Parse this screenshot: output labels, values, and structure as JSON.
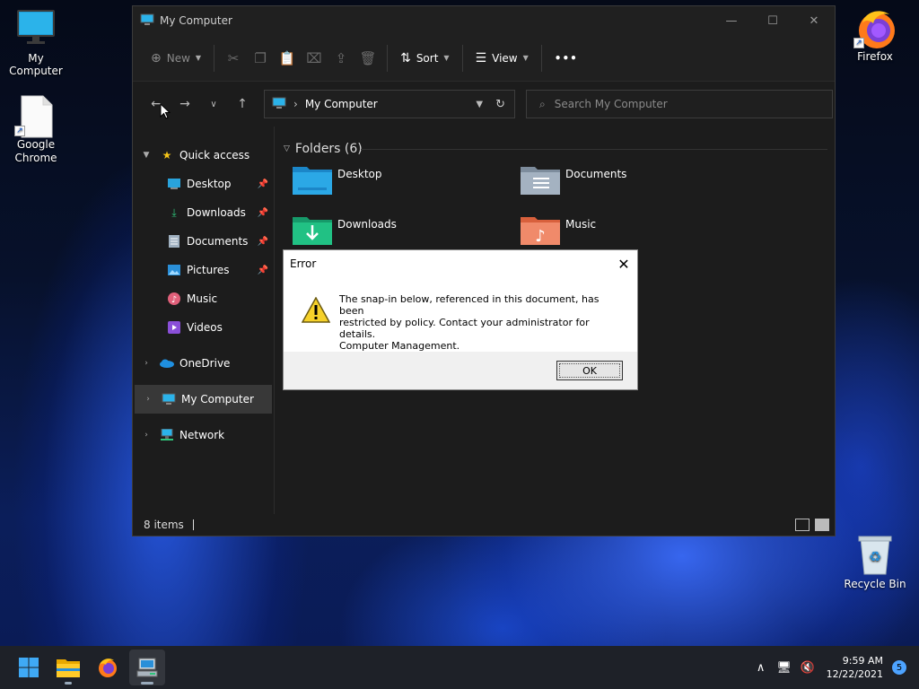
{
  "desktop": {
    "icons": [
      {
        "label": "My Computer"
      },
      {
        "label": "Google Chrome"
      },
      {
        "label": "Firefox"
      },
      {
        "label": "Recycle Bin"
      }
    ]
  },
  "explorer": {
    "title": "My Computer",
    "toolbar": {
      "new_label": "New",
      "sort_label": "Sort",
      "view_label": "View",
      "more_label": "•••"
    },
    "address": {
      "path": "My Computer"
    },
    "search": {
      "placeholder": "Search My Computer"
    },
    "navpane": {
      "quick_access": "Quick access",
      "items": [
        {
          "label": "Desktop"
        },
        {
          "label": "Downloads"
        },
        {
          "label": "Documents"
        },
        {
          "label": "Pictures"
        },
        {
          "label": "Music"
        },
        {
          "label": "Videos"
        }
      ],
      "onedrive": "OneDrive",
      "my_computer": "My Computer",
      "network": "Network"
    },
    "content": {
      "group_title": "Folders (6)",
      "folders": [
        {
          "label": "Desktop"
        },
        {
          "label": "Documents"
        },
        {
          "label": "Downloads"
        },
        {
          "label": "Music"
        }
      ]
    },
    "status": {
      "items_count": "8 items"
    }
  },
  "dialog": {
    "title": "Error",
    "message_line1": "The snap-in below, referenced in this document, has been",
    "message_line2": "restricted by policy. Contact your administrator for details.",
    "message_line3": "Computer Management.",
    "ok_label": "OK"
  },
  "taskbar": {
    "time": "9:59 AM",
    "date": "12/22/2021",
    "notifications": "5"
  }
}
